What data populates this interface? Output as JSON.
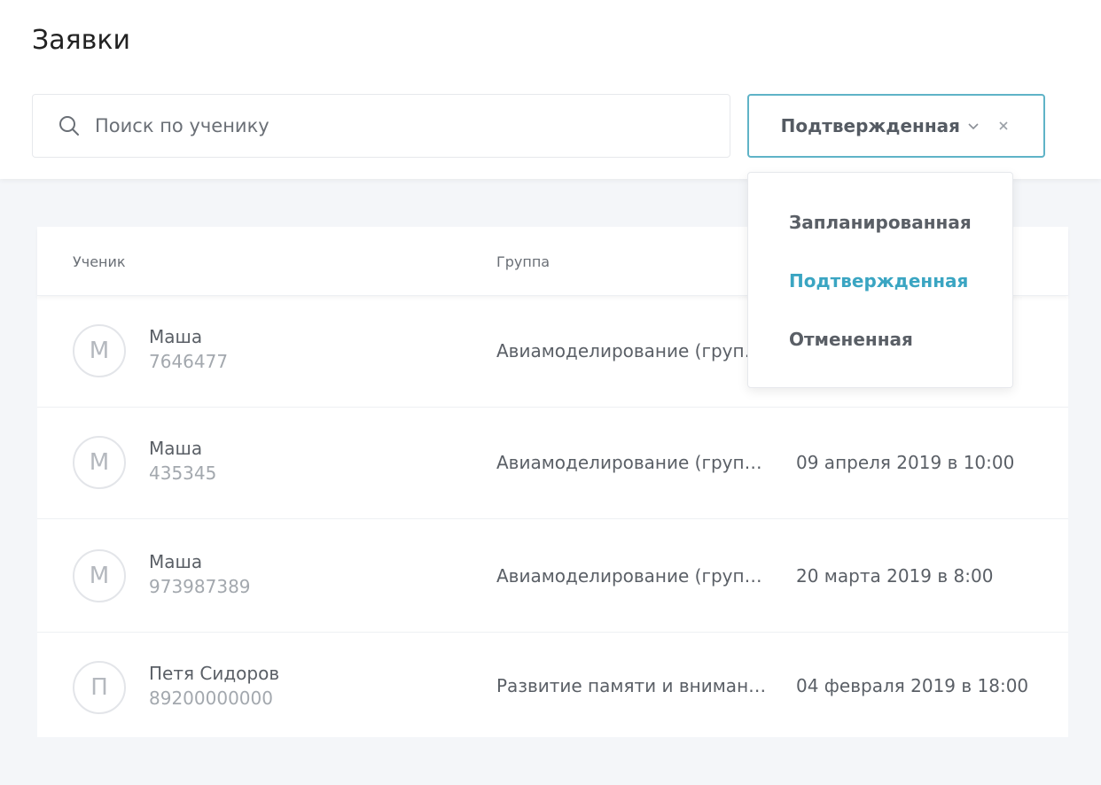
{
  "page": {
    "title": "Заявки"
  },
  "search": {
    "placeholder": "Поиск по ученику",
    "value": ""
  },
  "status_filter": {
    "selected": "Подтвержденная",
    "options": [
      "Запланированная",
      "Подтвержденная",
      "Отмененная"
    ]
  },
  "table": {
    "headers": {
      "student": "Ученик",
      "group": "Группа"
    },
    "rows": [
      {
        "initial": "М",
        "name": "Маша",
        "phone": "7646477",
        "group": "Авиамоделирование (группа)",
        "date": ""
      },
      {
        "initial": "М",
        "name": "Маша",
        "phone": "435345",
        "group": "Авиамоделирование (группа)",
        "date": "09 апреля 2019 в 10:00"
      },
      {
        "initial": "М",
        "name": "Маша",
        "phone": "973987389",
        "group": "Авиамоделирование (группа)",
        "date": "20 марта 2019 в 8:00"
      },
      {
        "initial": "П",
        "name": "Петя Сидоров",
        "phone": "89200000000",
        "group": "Развитие памяти и внимания",
        "date": "04 февраля 2019 в 18:00"
      }
    ]
  },
  "colors": {
    "accent": "#3aa5c2",
    "select_border": "#5fb3c7",
    "background": "#f4f6f9"
  },
  "icons": {
    "search": "search-icon",
    "dropdown": "chevron-down-icon",
    "clear": "close-icon"
  }
}
